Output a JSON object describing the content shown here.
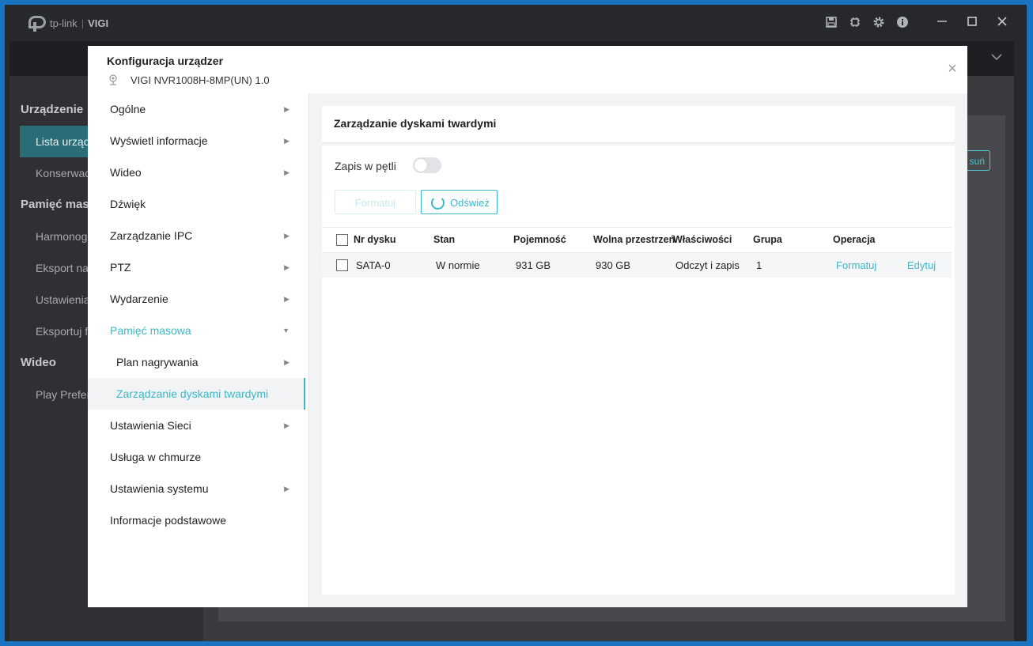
{
  "app": {
    "brand": "tp-link",
    "product": "VIGI"
  },
  "titlebar_icons": [
    "save-icon",
    "chip-icon",
    "gear-icon",
    "info-icon",
    "minimize-icon",
    "maximize-icon",
    "close-icon"
  ],
  "sidebar": {
    "sections": [
      {
        "title": "Urządzenie",
        "items": [
          "Lista urządz",
          "Konserwacja"
        ]
      },
      {
        "title": "Pamięć maso",
        "items": [
          "Harmonogra",
          "Eksport nag",
          "Ustawienia p",
          "Eksportuj fo"
        ]
      },
      {
        "title": "Wideo",
        "items": [
          "Play Prefere"
        ]
      }
    ]
  },
  "background": {
    "button_label": "suń"
  },
  "dialog": {
    "title": "Konfiguracja urządzer",
    "device": "VIGI NVR1008H-8MP(UN) 1.0",
    "close": "×"
  },
  "menu": {
    "items": [
      {
        "label": "Ogólne",
        "arrow": "▶"
      },
      {
        "label": "Wyświetl informacje",
        "arrow": "▶"
      },
      {
        "label": "Wideo",
        "arrow": "▶"
      },
      {
        "label": "Dźwięk",
        "arrow": ""
      },
      {
        "label": "Zarządzanie IPC",
        "arrow": "▶"
      },
      {
        "label": "PTZ",
        "arrow": "▶"
      },
      {
        "label": "Wydarzenie",
        "arrow": "▶"
      },
      {
        "label": "Pamięć masowa",
        "arrow": "▼"
      },
      {
        "label": "Plan nagrywania",
        "arrow": "▶"
      },
      {
        "label": "Zarządzanie dyskami twardymi",
        "arrow": ""
      },
      {
        "label": "Ustawienia Sieci",
        "arrow": "▶"
      },
      {
        "label": "Usługa w chmurze",
        "arrow": ""
      },
      {
        "label": "Ustawienia systemu",
        "arrow": "▶"
      },
      {
        "label": "Informacje podstawowe",
        "arrow": ""
      }
    ]
  },
  "panel": {
    "title": "Zarządzanie dyskami twardymi",
    "loop_label": "Zapis w pętli",
    "loop_enabled": false,
    "format_label": "Formatuj",
    "refresh_label": "Odśwież"
  },
  "table": {
    "headers": [
      "Nr dysku",
      "Stan",
      "Pojemność",
      "Wolna przestrzeń",
      "Właściwości",
      "Grupa",
      "Operacja"
    ],
    "rows": [
      {
        "disk": "SATA-0",
        "status": "W normie",
        "capacity": "931 GB",
        "free": "930 GB",
        "properties": "Odczyt i zapis",
        "group": "1",
        "op_format": "Formatuj",
        "op_edit": "Edytuj"
      }
    ]
  }
}
